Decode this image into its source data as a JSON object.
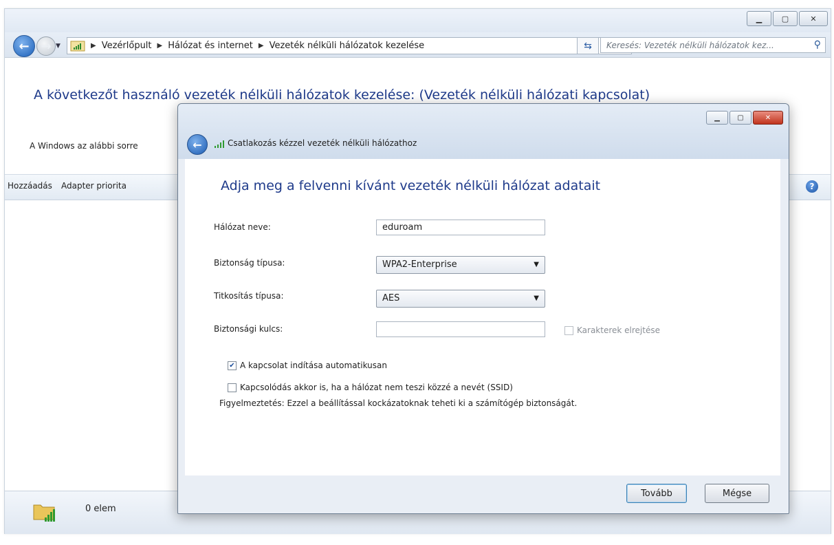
{
  "explorer": {
    "breadcrumb": [
      "Vezérlőpult",
      "Hálózat és internet",
      "Vezeték nélküli hálózatok kezelése"
    ],
    "search_placeholder": "Keresés: Vezeték nélküli hálózatok kez...",
    "heading": "A következőt használó vezeték nélküli hálózatok kezelése: (Vezeték nélküli hálózati kapcsolat)",
    "subtext": "A Windows az alábbi sorre",
    "toolbar": {
      "add": "Hozzáadás",
      "adapter": "Adapter priorita"
    },
    "status": "0 elem"
  },
  "dialog": {
    "title": "Csatlakozás kézzel vezeték nélküli hálózathoz",
    "heading": "Adja meg a felvenni kívánt vezeték nélküli hálózat adatait",
    "network_name_label": "Hálózat neve:",
    "network_name_value": "eduroam",
    "security_type_label": "Biztonság típusa:",
    "security_type_value": "WPA2-Enterprise",
    "encryption_type_label": "Titkosítás típusa:",
    "encryption_type_value": "AES",
    "security_key_label": "Biztonsági kulcs:",
    "security_key_value": "",
    "hide_chars_label": "Karakterek elrejtése",
    "auto_start_label": "A kapcsolat indítása automatikusan",
    "auto_start_checked": true,
    "connect_hidden_label": "Kapcsolódás akkor is, ha a hálózat nem teszi közzé a nevét (SSID)",
    "warning": "Figyelmeztetés: Ezzel a beállítással kockázatoknak teheti ki a számítógép biztonságát.",
    "next_button": "Tovább",
    "cancel_button": "Mégse"
  }
}
